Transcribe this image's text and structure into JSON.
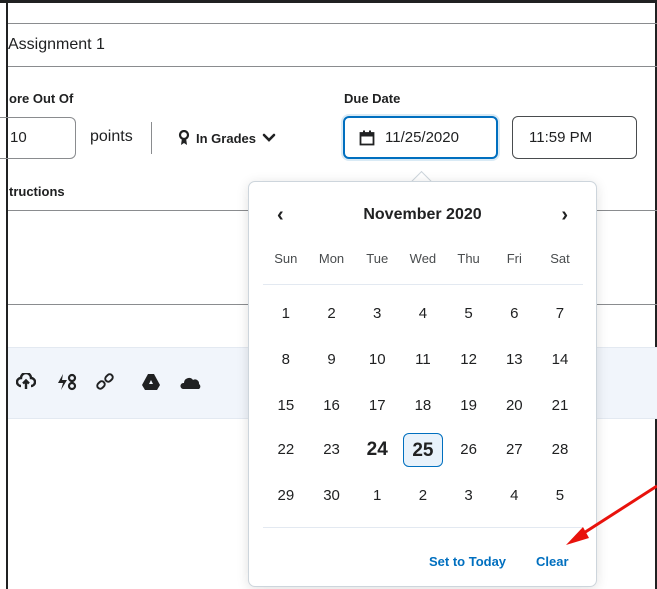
{
  "assignment": {
    "title_value": "Assignment 1"
  },
  "score": {
    "label": "ore Out Of",
    "value": "10",
    "unit": "points",
    "grades_label": "In Grades"
  },
  "due_date": {
    "label": "Due Date",
    "date_value": "11/25/2020",
    "time_value": "11:59 PM"
  },
  "instructions": {
    "label": "tructions"
  },
  "toolbar": {
    "icons": [
      "upload-icon",
      "quicklink-icon",
      "link-icon",
      "google-drive-icon",
      "onedrive-icon"
    ]
  },
  "calendar": {
    "month_title": "November 2020",
    "prev_glyph": "‹",
    "next_glyph": "›",
    "weekdays": [
      "Sun",
      "Mon",
      "Tue",
      "Wed",
      "Thu",
      "Fri",
      "Sat"
    ],
    "weeks": [
      [
        "1",
        "2",
        "3",
        "4",
        "5",
        "6",
        "7"
      ],
      [
        "8",
        "9",
        "10",
        "11",
        "12",
        "13",
        "14"
      ],
      [
        "15",
        "16",
        "17",
        "18",
        "19",
        "20",
        "21"
      ],
      [
        "22",
        "23",
        "24",
        "25",
        "26",
        "27",
        "28"
      ],
      [
        "29",
        "30",
        "1",
        "2",
        "3",
        "4",
        "5"
      ]
    ],
    "today": "24",
    "selected": "25",
    "set_today_label": "Set to Today",
    "clear_label": "Clear"
  },
  "colors": {
    "accent": "#006fbf",
    "annotation_arrow": "#e8120c"
  }
}
